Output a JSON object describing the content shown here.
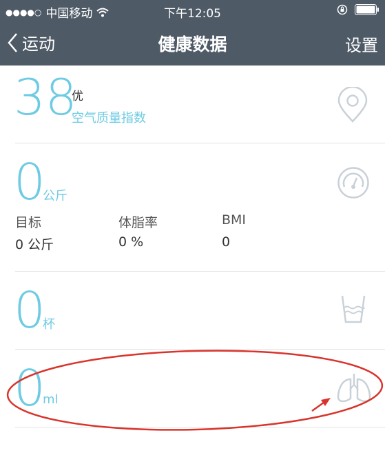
{
  "status_bar": {
    "carrier": "中国移动",
    "signal": "●●●●○",
    "time": "下午12:05"
  },
  "nav": {
    "back_label": "运动",
    "title": "健康数据",
    "settings_label": "设置"
  },
  "air": {
    "value": "38",
    "grade": "优",
    "label": "空气质量指数",
    "icon": "location-pin-icon"
  },
  "weight": {
    "value": "0",
    "unit": "公斤",
    "icon": "gauge-icon",
    "stats": [
      {
        "label": "目标",
        "value": "0 公斤"
      },
      {
        "label": "体脂率",
        "value": "0 %"
      },
      {
        "label": "BMI",
        "value": "0"
      }
    ]
  },
  "water": {
    "value": "0",
    "unit": "杯",
    "icon": "water-cup-icon"
  },
  "lung": {
    "value": "0",
    "unit": "ml",
    "icon": "lungs-icon"
  },
  "colors": {
    "header": "#4e5a66",
    "accent": "#6fcbe3",
    "annotation": "#d9342b"
  }
}
